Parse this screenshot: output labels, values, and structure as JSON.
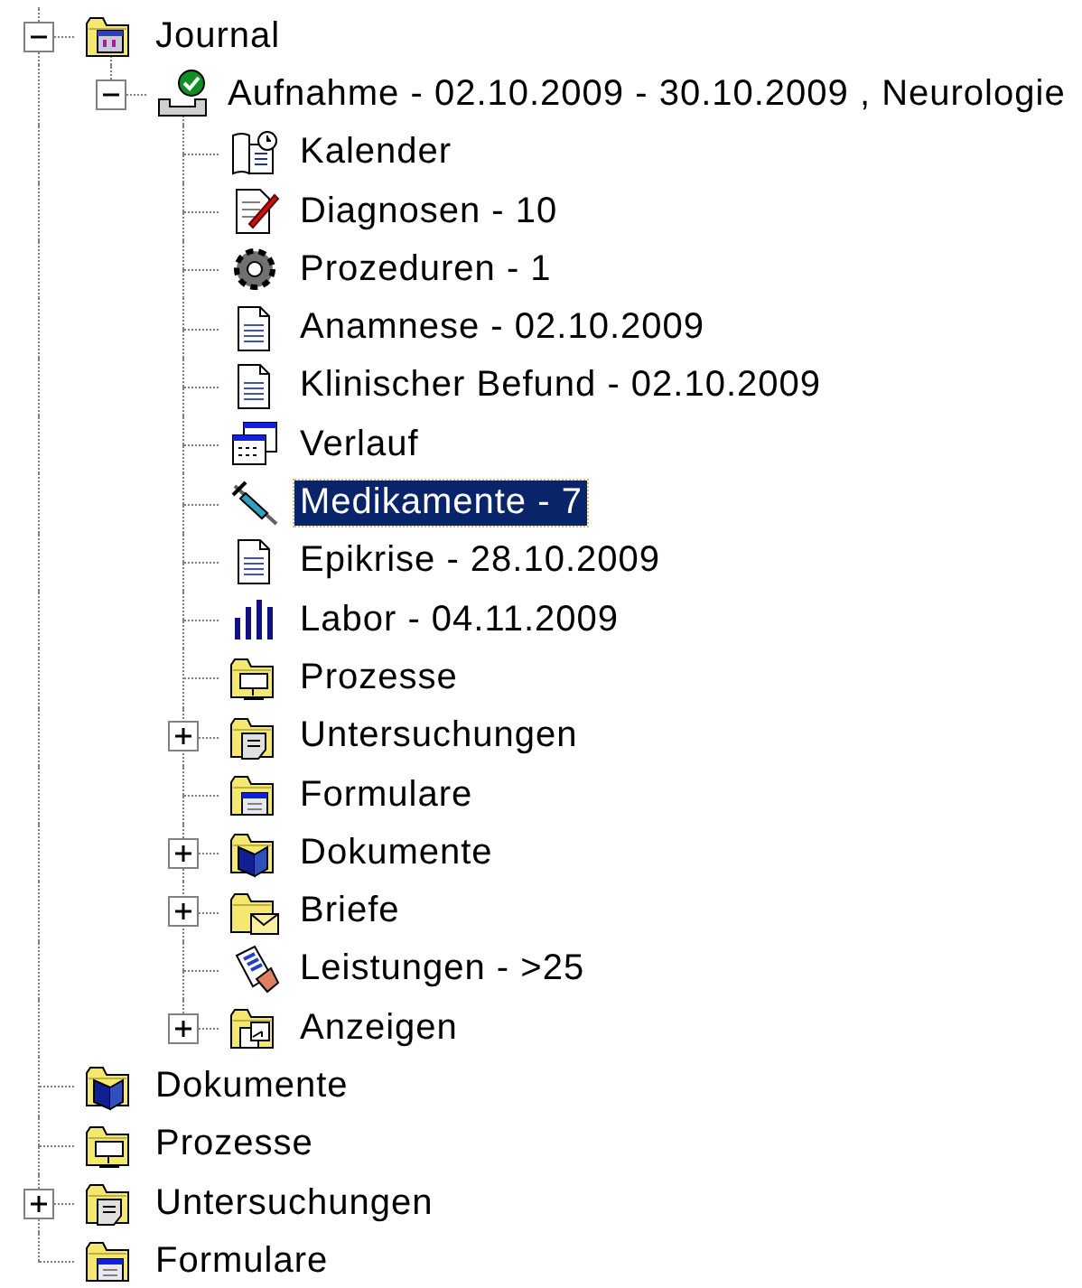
{
  "tree": [
    {
      "label": "Journal",
      "kind": "journal",
      "expanded": true,
      "selected": false,
      "children": [
        {
          "label": "Aufnahme - 02.10.2009 - 30.10.2009 , Neurologie",
          "kind": "admission",
          "expanded": true,
          "selected": false,
          "children": [
            {
              "label": "Kalender",
              "kind": "calendar",
              "selected": false
            },
            {
              "label": "Diagnosen - 10",
              "kind": "diagnosis",
              "selected": false
            },
            {
              "label": "Prozeduren - 1",
              "kind": "gear",
              "selected": false
            },
            {
              "label": "Anamnese - 02.10.2009",
              "kind": "document",
              "selected": false
            },
            {
              "label": "Klinischer Befund - 02.10.2009",
              "kind": "document",
              "selected": false
            },
            {
              "label": "Verlauf",
              "kind": "schedule",
              "selected": false
            },
            {
              "label": "Medikamente - 7",
              "kind": "syringe",
              "selected": true
            },
            {
              "label": "Epikrise - 28.10.2009",
              "kind": "document",
              "selected": false
            },
            {
              "label": "Labor - 04.11.2009",
              "kind": "bars",
              "selected": false
            },
            {
              "label": "Prozesse",
              "kind": "folder-process",
              "selected": false
            },
            {
              "label": "Untersuchungen",
              "kind": "folder-exam",
              "expanded": false,
              "selected": false
            },
            {
              "label": "Formulare",
              "kind": "folder-form",
              "selected": false
            },
            {
              "label": "Dokumente",
              "kind": "folder-docs",
              "expanded": false,
              "selected": false
            },
            {
              "label": "Briefe",
              "kind": "folder-letters",
              "expanded": false,
              "selected": false
            },
            {
              "label": "Leistungen - >25",
              "kind": "services",
              "selected": false
            },
            {
              "label": "Anzeigen",
              "kind": "folder-display",
              "expanded": false,
              "selected": false
            }
          ]
        }
      ]
    },
    {
      "label": "Dokumente",
      "kind": "folder-docs",
      "selected": false
    },
    {
      "label": "Prozesse",
      "kind": "folder-process",
      "selected": false
    },
    {
      "label": "Untersuchungen",
      "kind": "folder-exam",
      "expanded": false,
      "selected": false
    },
    {
      "label": "Formulare",
      "kind": "folder-form",
      "selected": false
    }
  ]
}
